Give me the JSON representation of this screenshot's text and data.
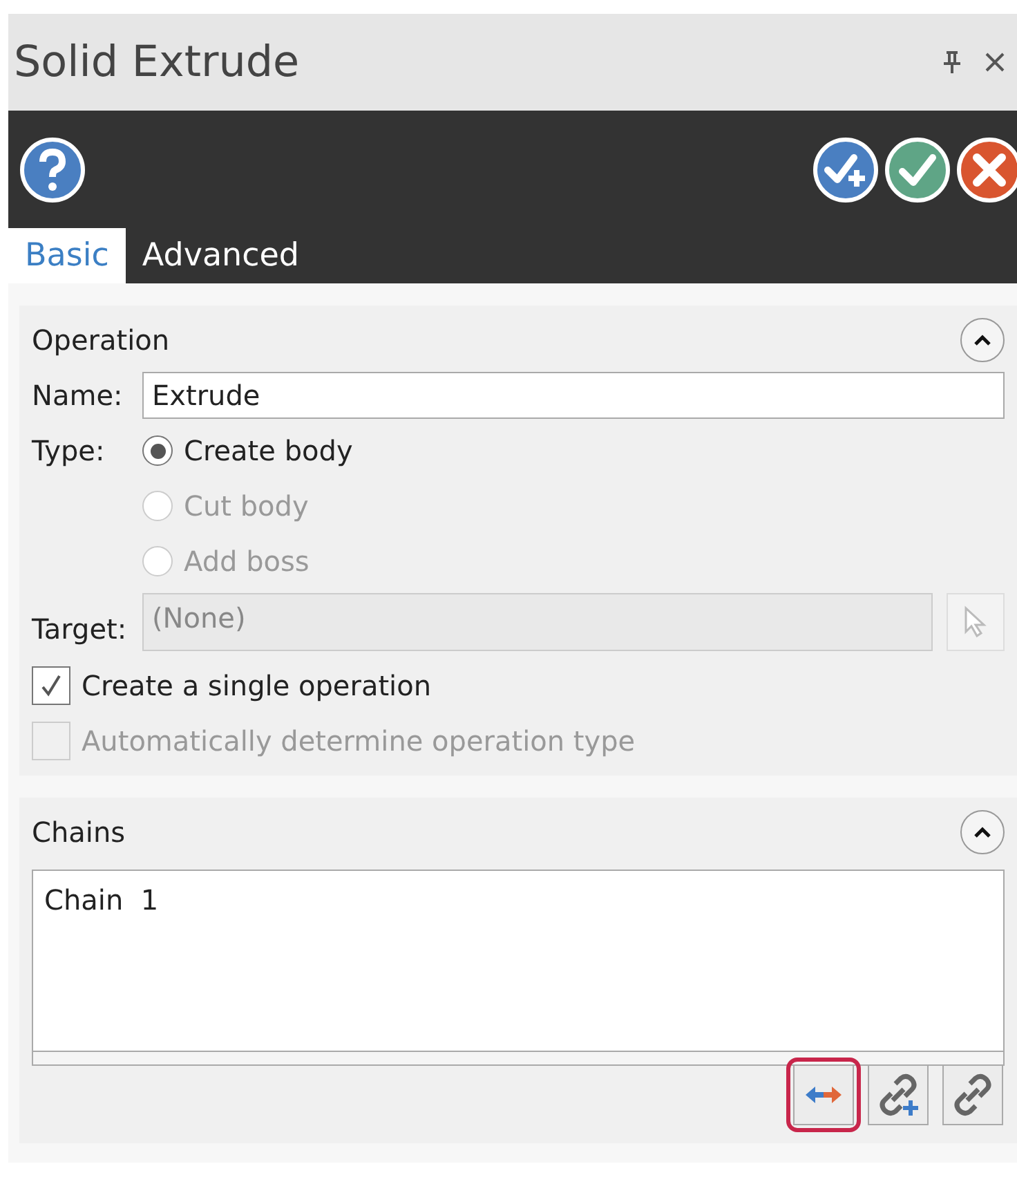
{
  "window": {
    "title": "Solid Extrude"
  },
  "toolbar": {
    "actions": [
      {
        "kind": "ok-new"
      },
      {
        "kind": "ok"
      },
      {
        "kind": "cancel"
      }
    ]
  },
  "tabs": [
    {
      "label": "Basic",
      "selected": true
    },
    {
      "label": "Advanced",
      "selected": false
    }
  ],
  "operation": {
    "title": "Operation",
    "expanded": true,
    "name_label": "Name:",
    "name_value": "Extrude",
    "type_label": "Type:",
    "types": [
      {
        "label": "Create body",
        "selected": true,
        "disabled": false
      },
      {
        "label": "Cut body",
        "selected": false,
        "disabled": true
      },
      {
        "label": "Add boss",
        "selected": false,
        "disabled": true
      }
    ],
    "target_label": "Target:",
    "target_value": "(None)",
    "checkboxes": [
      {
        "label": "Create a single operation",
        "checked": true,
        "disabled": false
      },
      {
        "label": "Automatically determine operation type",
        "checked": false,
        "disabled": true
      }
    ]
  },
  "chains": {
    "title": "Chains",
    "expanded": true,
    "items": [
      "Chain  1"
    ],
    "buttons": [
      {
        "kind": "reverse",
        "highlighted": true
      },
      {
        "kind": "add-chain",
        "highlighted": false
      },
      {
        "kind": "chain",
        "highlighted": false
      }
    ]
  }
}
